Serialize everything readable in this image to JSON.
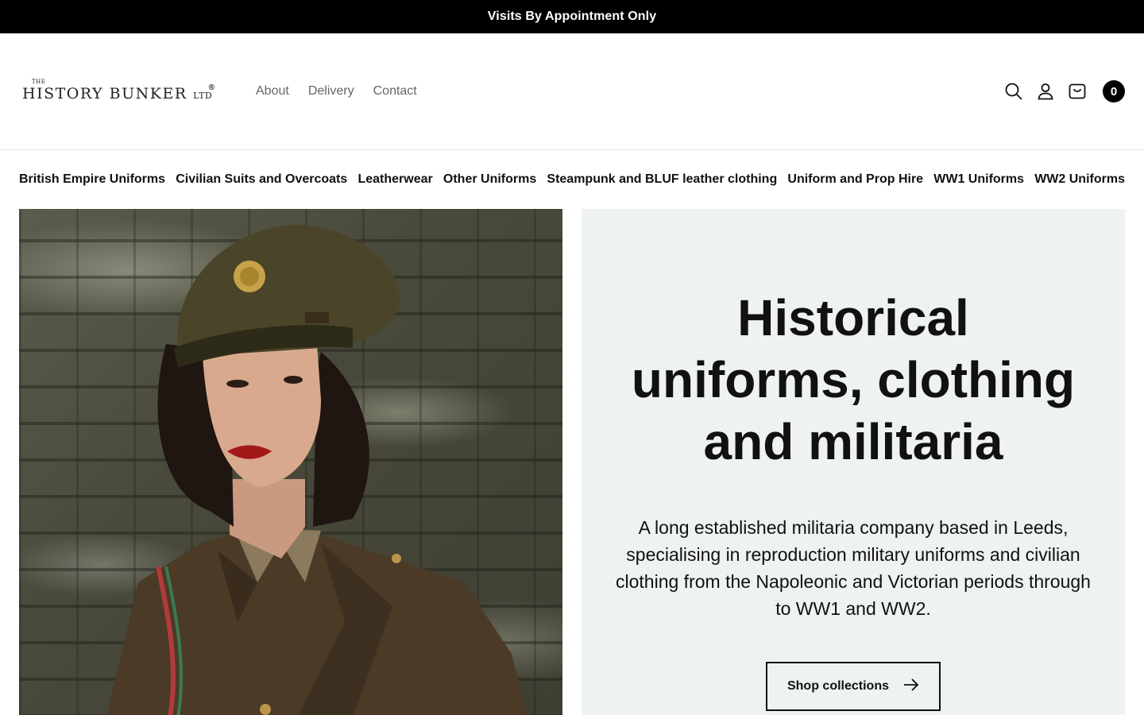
{
  "announcement": {
    "text": "Visits By Appointment Only"
  },
  "logo": {
    "the": "THE",
    "main": "HISTORY BUNKER",
    "ltd": "LTD",
    "reg": "®"
  },
  "top_nav": [
    {
      "label": "About"
    },
    {
      "label": "Delivery"
    },
    {
      "label": "Contact"
    }
  ],
  "header_icons": {
    "search": "search-icon",
    "account": "user-icon",
    "cart": "cart-icon",
    "cart_count": "0"
  },
  "collections": [
    {
      "label": "British Empire Uniforms"
    },
    {
      "label": "Civilian Suits and Overcoats"
    },
    {
      "label": "Leatherwear"
    },
    {
      "label": "Other Uniforms"
    },
    {
      "label": "Steampunk and BLUF leather clothing"
    },
    {
      "label": "Uniform and Prop Hire"
    },
    {
      "label": "WW1 Uniforms"
    },
    {
      "label": "WW2 Uniforms"
    }
  ],
  "hero": {
    "title": "Historical uniforms, clothing and militaria",
    "text": "A long established militaria company based in Leeds, specialising in reproduction military uniforms and civilian clothing from the Napoleonic and Victorian periods through to WW1 and WW2.",
    "cta": "Shop collections",
    "panel_bg": "#eef3ef"
  }
}
